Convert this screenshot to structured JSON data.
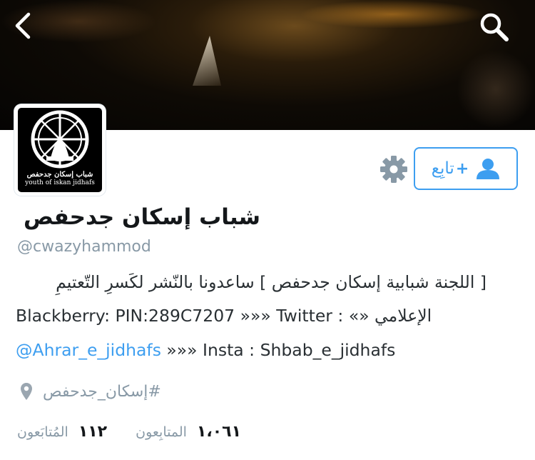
{
  "profile": {
    "name": "شباب إسكان جدحفص",
    "handle": "@cwazyhammod",
    "avatar_line1": "شباب إسكان جدحفص",
    "avatar_line2": "youth of iskan jidhafs",
    "bio_line1": "[ اللجنة شبابية إسكان جدحفص ] ساعدونا بالنّشر لكَسرِ التّعتيمِ",
    "bio_line2_a": "Blackberry: PIN:289C7207 »»» Twitter : ",
    "bio_line2_b": "الإعلامي «»",
    "bio_line3_mention": "@Ahrar_e_jidhafs",
    "bio_line3_rest": " »»» Insta : Shbab_e_jidhafs",
    "location": "#إسكان_جدحفص"
  },
  "actions": {
    "follow_label": "تابِع",
    "follow_plus": "+"
  },
  "stats": {
    "following_count": "١١٢",
    "following_label": "المُتابَعون",
    "followers_count": "١،٠٦١",
    "followers_label": "المتابِعون"
  },
  "colors": {
    "accent": "#3d9ef0",
    "muted": "#8899a6",
    "text": "#292f33"
  },
  "icons": [
    "back-arrow-icon",
    "search-icon",
    "gear-icon",
    "add-user-icon",
    "location-pin-icon"
  ]
}
